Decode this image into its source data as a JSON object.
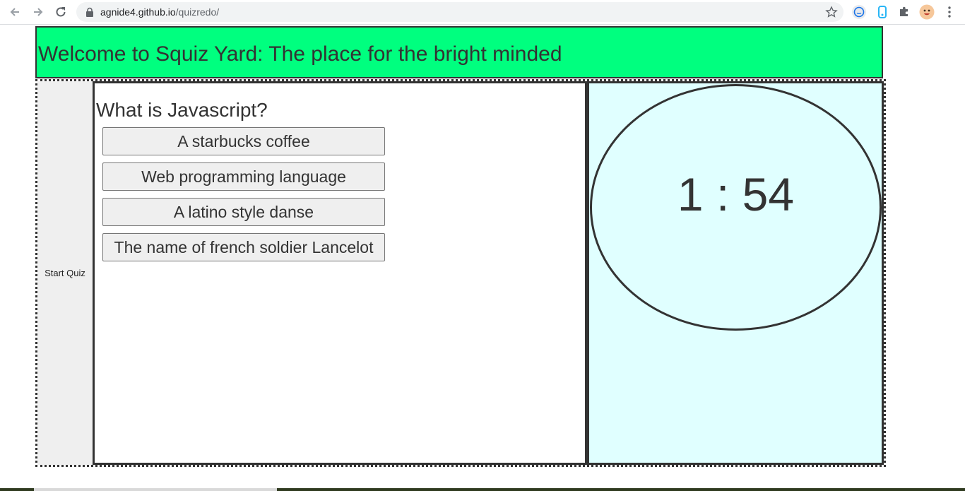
{
  "browser": {
    "url_host": "agnide4.github.io",
    "url_path": "/quizredo/",
    "icons": {
      "back": "arrow-left-icon",
      "forward": "arrow-right-icon",
      "reload": "reload-icon",
      "lock": "lock-icon",
      "bookmark": "star-icon",
      "extensions": [
        "chat-extension-icon",
        "phone-extension-icon",
        "puzzle-icon",
        "profile-avatar",
        "kebab-menu-icon"
      ]
    }
  },
  "header": {
    "title": "Welcome to Squiz Yard: The place for the bright minded"
  },
  "sidebar": {
    "start_label": "Start Quiz"
  },
  "quiz": {
    "question": "What is Javascript?",
    "answers": [
      "A starbucks coffee",
      "Web programming language",
      "A latino style danse",
      "The name of french soldier Lancelot"
    ]
  },
  "timer": {
    "display": "1 : 54"
  },
  "colors": {
    "header_bg": "#00ff7f",
    "timer_bg": "#e0ffff",
    "sidebar_bg": "#efefef",
    "border": "#333333"
  }
}
